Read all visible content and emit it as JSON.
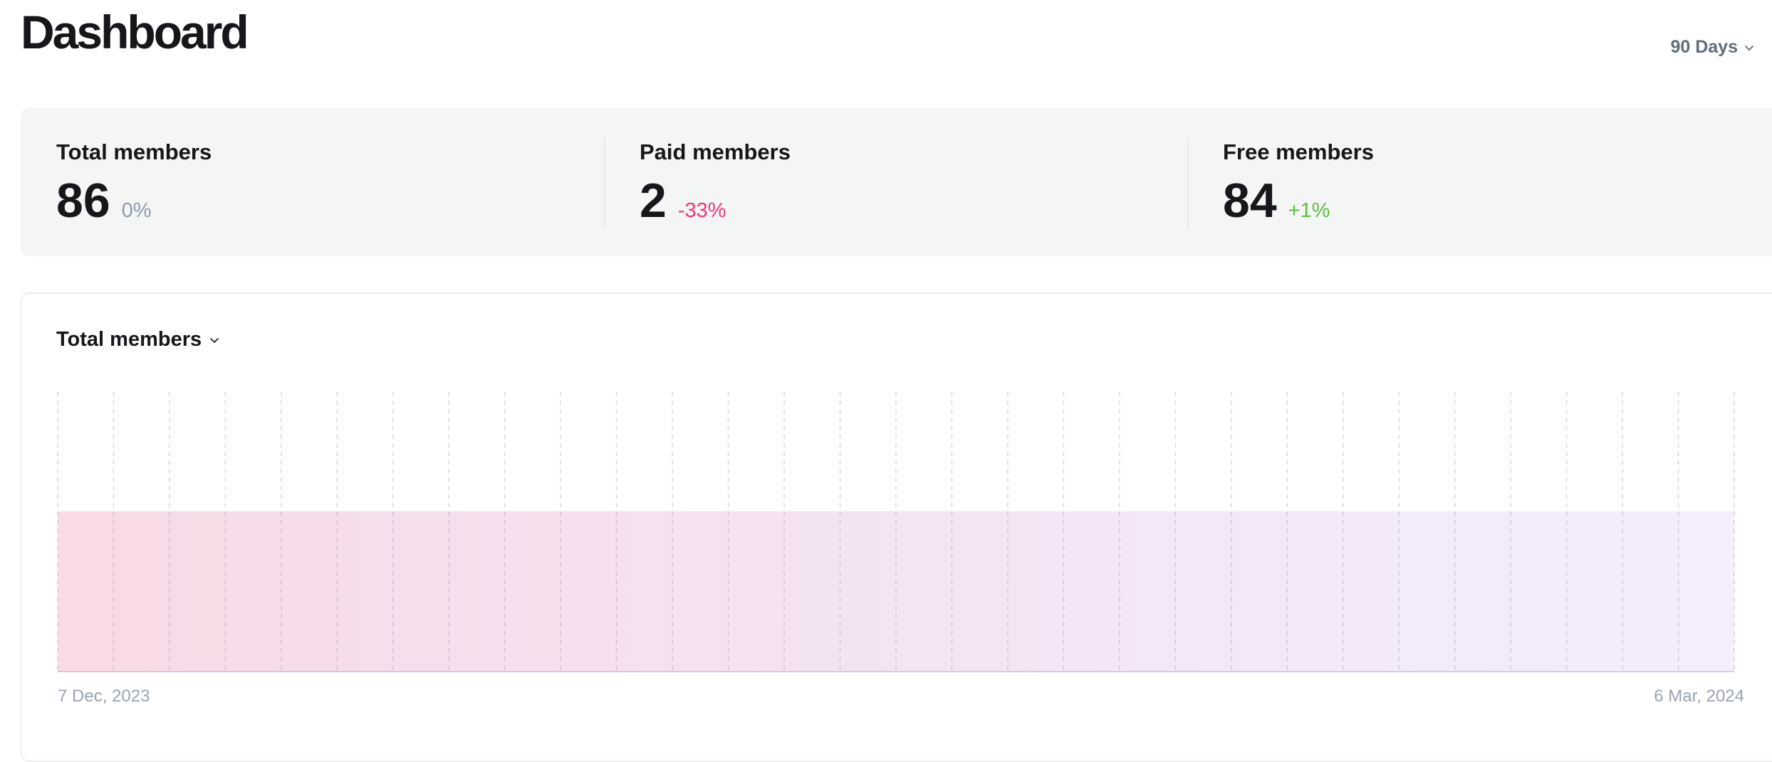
{
  "header": {
    "title": "Dashboard",
    "range_label": "90 Days",
    "range_icon": "chevron-down-icon"
  },
  "kpis": [
    {
      "label": "Total members",
      "value": "86",
      "delta": "0%",
      "delta_color": "#8e9cac"
    },
    {
      "label": "Paid members",
      "value": "2",
      "delta": "-33%",
      "delta_color": "#e8397c"
    },
    {
      "label": "Free members",
      "value": "84",
      "delta": "+1%",
      "delta_color": "#5fbd3f"
    }
  ],
  "chart": {
    "metric_label": "Total members",
    "metric_icon": "chevron-down-icon",
    "start_label": "7 Dec, 2023",
    "end_label": "6 Mar, 2024"
  },
  "chart_data": {
    "type": "area",
    "x_start": "7 Dec, 2023",
    "x_end": "6 Mar, 2024",
    "series": [
      {
        "values": [
          86,
          86,
          86,
          86,
          86,
          86,
          86,
          86,
          86,
          86,
          86,
          86,
          86,
          86,
          86,
          86,
          86,
          86,
          86,
          86,
          86,
          86,
          86,
          86,
          86,
          86,
          86,
          86,
          86,
          86,
          86
        ]
      }
    ],
    "ylim": [
      0,
      150
    ],
    "grid": "vertical dashed",
    "colors": {
      "start": "#e2457f",
      "end": "#8b4ee6"
    }
  }
}
